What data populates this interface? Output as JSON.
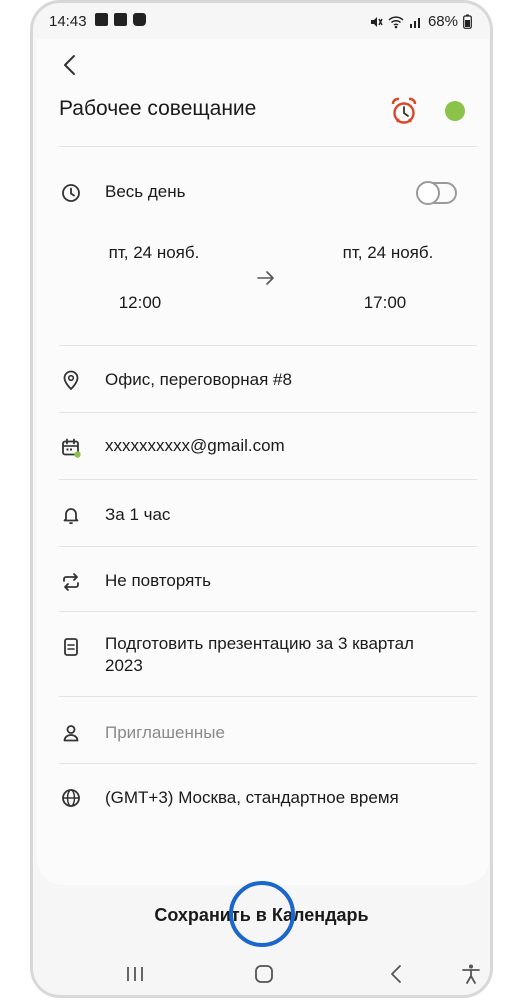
{
  "status_bar": {
    "time": "14:43",
    "battery": "68%"
  },
  "event": {
    "title": "Рабочее совещание",
    "color": "#8bc34a"
  },
  "all_day": {
    "label": "Весь день",
    "enabled": false
  },
  "start": {
    "date": "пт, 24 нояб.",
    "time": "12:00"
  },
  "end": {
    "date": "пт, 24 нояб.",
    "time": "17:00"
  },
  "location": "Офис, переговорная #8",
  "calendar_account": "xxxxxxxxxx@gmail.com",
  "reminder": "За 1 час",
  "repeat": "Не повторять",
  "notes_line1": "Подготовить презентацию за 3 квартал",
  "notes_line2": "2023",
  "invitees_placeholder": "Приглашенные",
  "timezone": "(GMT+3) Москва, стандартное время",
  "save_button": "Сохранить в Календарь",
  "colors": {
    "highlight": "#1a66cc",
    "accent_green": "#8bc34a",
    "alarm_red": "#d84a2a"
  }
}
